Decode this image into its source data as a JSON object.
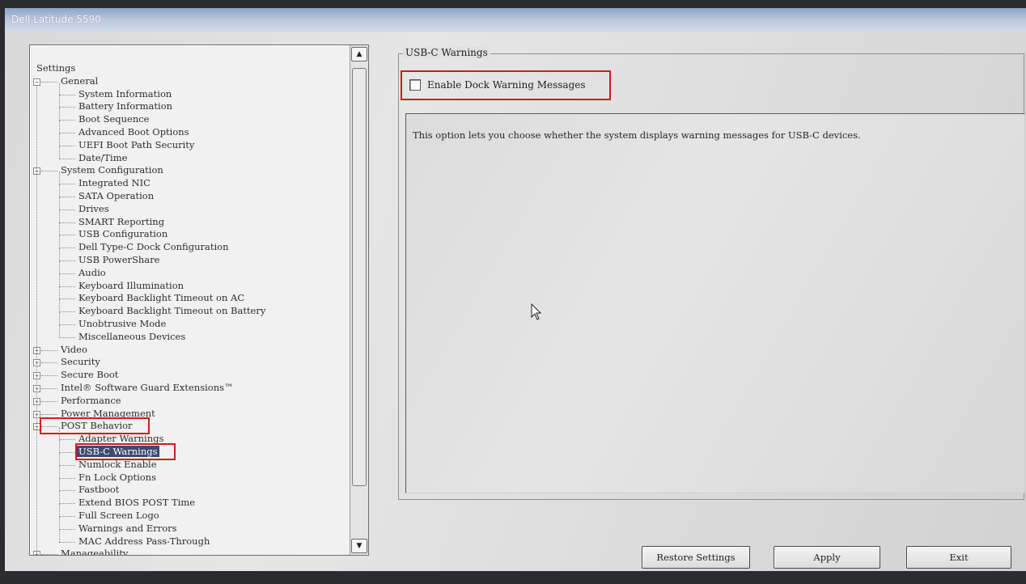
{
  "window": {
    "title": "Dell Latitude 5590"
  },
  "tree": {
    "items": [
      {
        "label": "Settings",
        "level": 0
      },
      {
        "label": "General",
        "level": 1,
        "expander": "−"
      },
      {
        "label": "System Information",
        "level": 2
      },
      {
        "label": "Battery Information",
        "level": 2
      },
      {
        "label": "Boot Sequence",
        "level": 2
      },
      {
        "label": "Advanced Boot Options",
        "level": 2
      },
      {
        "label": "UEFI Boot Path Security",
        "level": 2
      },
      {
        "label": "Date/Time",
        "level": 2
      },
      {
        "label": "System Configuration",
        "level": 1,
        "expander": "−"
      },
      {
        "label": "Integrated NIC",
        "level": 2
      },
      {
        "label": "SATA Operation",
        "level": 2
      },
      {
        "label": "Drives",
        "level": 2
      },
      {
        "label": "SMART Reporting",
        "level": 2
      },
      {
        "label": "USB Configuration",
        "level": 2
      },
      {
        "label": "Dell Type-C Dock Configuration",
        "level": 2
      },
      {
        "label": "USB PowerShare",
        "level": 2
      },
      {
        "label": "Audio",
        "level": 2
      },
      {
        "label": "Keyboard Illumination",
        "level": 2
      },
      {
        "label": "Keyboard Backlight Timeout on AC",
        "level": 2
      },
      {
        "label": "Keyboard Backlight Timeout on Battery",
        "level": 2
      },
      {
        "label": "Unobtrusive Mode",
        "level": 2
      },
      {
        "label": "Miscellaneous Devices",
        "level": 2
      },
      {
        "label": "Video",
        "level": 1,
        "expander": "+"
      },
      {
        "label": "Security",
        "level": 1,
        "expander": "+"
      },
      {
        "label": "Secure Boot",
        "level": 1,
        "expander": "+"
      },
      {
        "label": "Intel® Software Guard Extensions™",
        "level": 1,
        "expander": "+"
      },
      {
        "label": "Performance",
        "level": 1,
        "expander": "+"
      },
      {
        "label": "Power Management",
        "level": 1,
        "expander": "+"
      },
      {
        "label": "POST Behavior",
        "level": 1,
        "expander": "−",
        "highlight": true
      },
      {
        "label": "Adapter Warnings",
        "level": 2
      },
      {
        "label": "USB-C Warnings",
        "level": 2,
        "selected": true,
        "highlight": true
      },
      {
        "label": "Numlock Enable",
        "level": 2
      },
      {
        "label": "Fn Lock Options",
        "level": 2
      },
      {
        "label": "Fastboot",
        "level": 2
      },
      {
        "label": "Extend BIOS POST Time",
        "level": 2
      },
      {
        "label": "Full Screen Logo",
        "level": 2
      },
      {
        "label": "Warnings and Errors",
        "level": 2
      },
      {
        "label": "MAC Address Pass-Through",
        "level": 2
      },
      {
        "label": "Manageability",
        "level": 1,
        "expander": "+"
      }
    ],
    "scroll_up_icon": "triangle-up-icon",
    "scroll_down_icon": "triangle-down-icon"
  },
  "panel": {
    "group_title": "USB-C Warnings",
    "checkbox_label": "Enable Dock Warning Messages",
    "checkbox_checked": false,
    "description": "This option lets you choose whether the system displays warning messages for USB-C devices."
  },
  "buttons": {
    "restore": "Restore Settings",
    "apply": "Apply",
    "exit": "Exit"
  },
  "colors": {
    "highlight_box": "#d01c1c",
    "selection": "#3e4a6e"
  }
}
